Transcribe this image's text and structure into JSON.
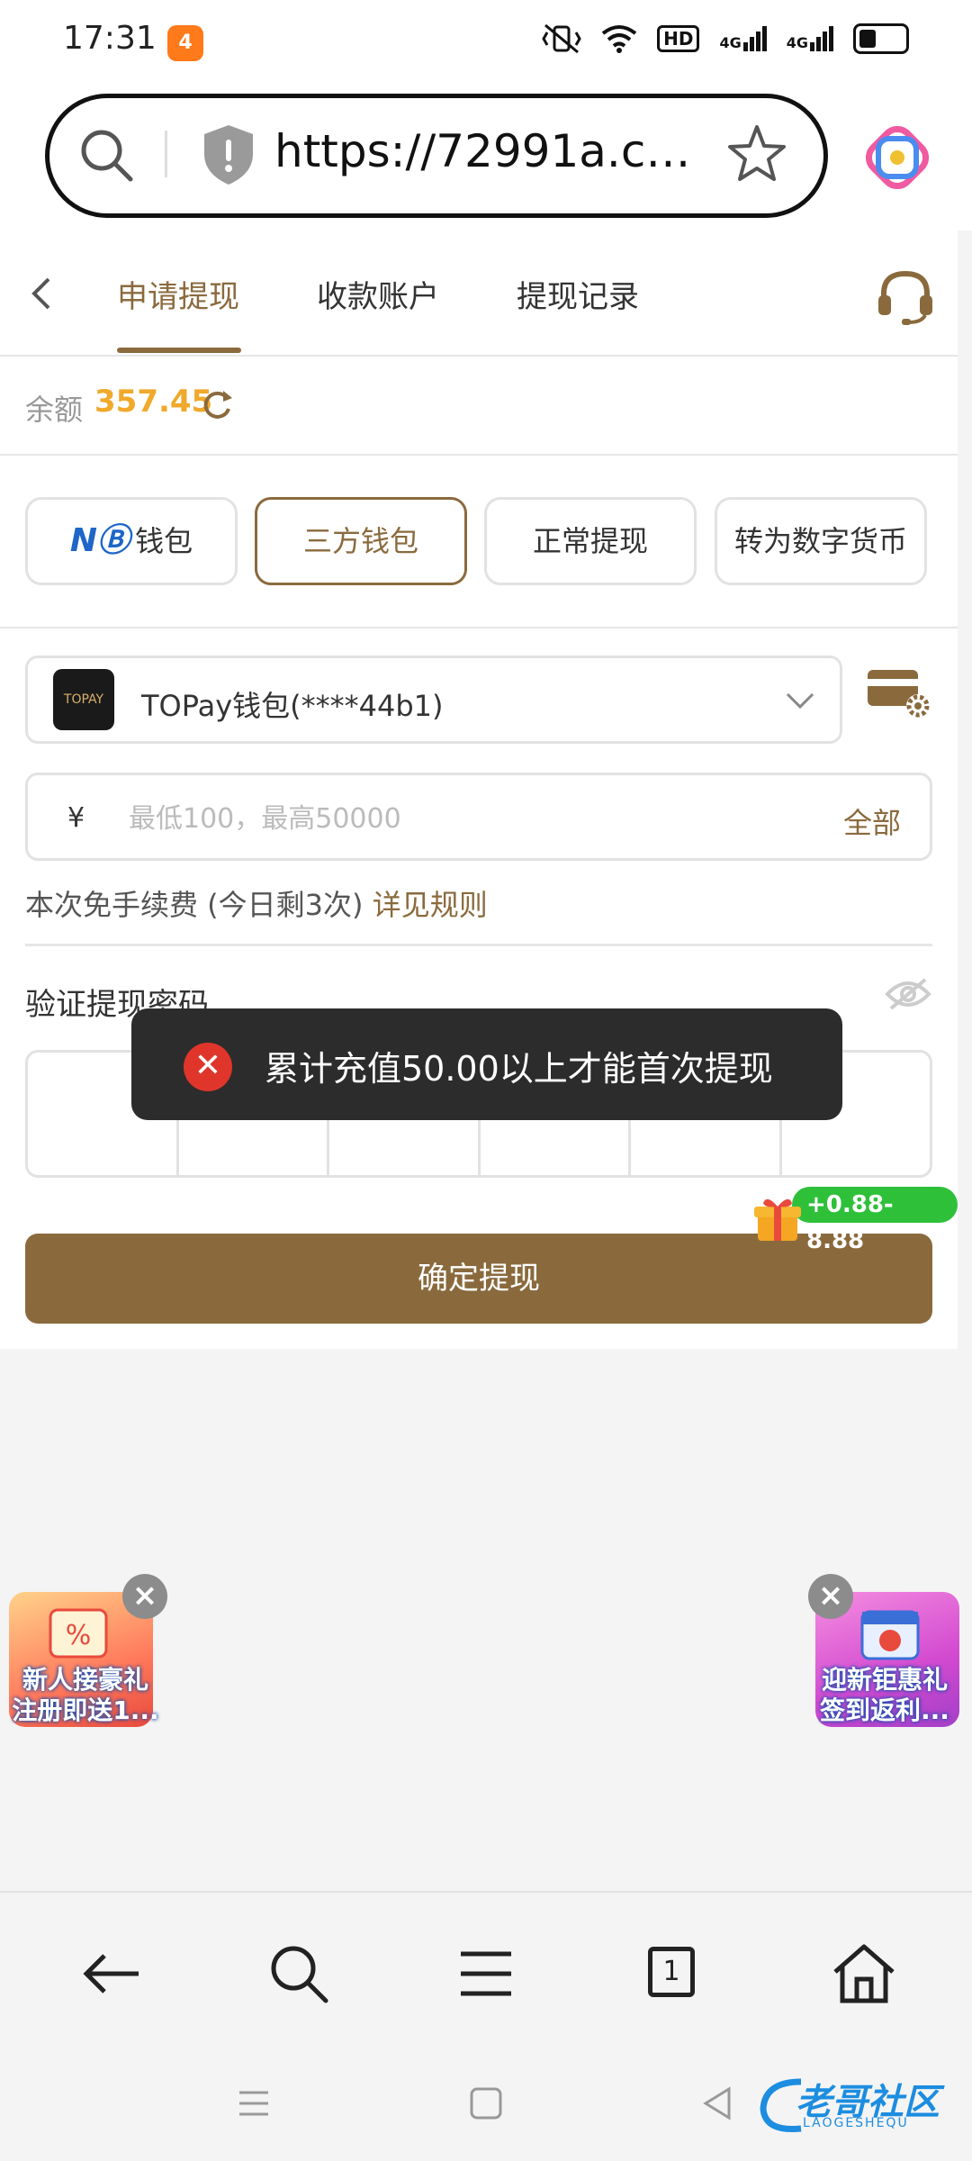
{
  "status_bar": {
    "time": "17:31",
    "app_icon_text": "4",
    "hd_label": "HD",
    "net1": "4G",
    "net2": "4G"
  },
  "browser": {
    "url": "https://72991a.com..."
  },
  "header": {
    "tabs": [
      {
        "label": "申请提现",
        "active": true
      },
      {
        "label": "收款账户",
        "active": false
      },
      {
        "label": "提现记录",
        "active": false
      }
    ]
  },
  "balance": {
    "label": "余额",
    "value": "357.45"
  },
  "methods": {
    "nb_logo": "NⒷ",
    "items": [
      {
        "label": "钱包"
      },
      {
        "label": "三方钱包",
        "selected": true
      },
      {
        "label": "正常提现"
      },
      {
        "label": "转为数字货币"
      }
    ]
  },
  "wallet": {
    "logo_text": "TOPAY",
    "name": "TOPay钱包(****44b1)"
  },
  "amount": {
    "currency": "¥",
    "placeholder": "最低100，最高50000",
    "value": "",
    "all_label": "全部"
  },
  "fee": {
    "text": "本次免手续费 (今日剩3次) ",
    "link": "详见规则"
  },
  "password": {
    "label": "验证提现密码"
  },
  "submit": {
    "label": "确定提现"
  },
  "gift_badge": "+0.88-8.88",
  "toast": {
    "message": "累计充值50.00以上才能首次提现"
  },
  "promos": {
    "left": {
      "line1": "新人接豪礼",
      "line2": "注册即送1..."
    },
    "right": {
      "line1": "迎新钜惠礼",
      "line2": "签到返利..."
    }
  },
  "bottom_nav": {
    "tab_count": "1"
  },
  "watermark": {
    "text": "老哥社区",
    "sub": "LAOGESHEQU"
  },
  "colors": {
    "accent": "#8a6a3d",
    "balance": "#f0a92b",
    "toast_bg": "#2c2c2c",
    "error": "#e0352b",
    "badge": "#2fc03a"
  }
}
